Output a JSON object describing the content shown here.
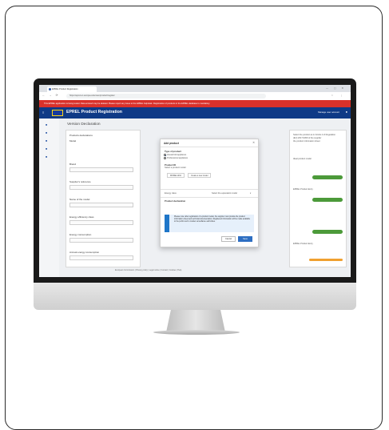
{
  "browser": {
    "tab_title": "EPREL Product Registration",
    "url": "https://eprel.ec.europa.eu/screen/product/register",
    "banner_text": "This EPREL application is being tested. Data entered may be deleted. Please report any issue to the EPREL helpdesk. Registration of products in the EPREL database is mandatory."
  },
  "app": {
    "title": "EPREL Product Registration",
    "user": "Manage user account"
  },
  "sidebar": {
    "items": [
      "■",
      "■",
      "■",
      "■",
      "■"
    ]
  },
  "page": {
    "title": "Version Declaration",
    "form_labels": [
      "Products declarations",
      "Model",
      "Brand",
      "Supplier's reference",
      "Name of the model",
      "Energy efficiency class",
      "Energy consumption",
      "Annual energy consumption"
    ]
  },
  "right_panel": {
    "lines": [
      "Select the product as in Article 4 of Regulation",
      "(EU) 2017/1369 of the supplier",
      "the product information sheet",
      "Ideal product model",
      "EPREL Product Entry",
      "EPREL Product Entry"
    ],
    "buttons": [
      "Validate",
      "Validate"
    ]
  },
  "footer": {
    "text": "European Commission | Privacy policy | Legal notice | Contact | Cookies | Help"
  },
  "modal": {
    "title": "Add product",
    "section1_label": "Type of product",
    "options": [
      "Household appliance",
      "Professional appliance"
    ],
    "section2_label": "Product ID",
    "section2_hint": "Select a product model",
    "chips": [
      "MODEL1234",
      "Create a new model"
    ],
    "section3_left": "Energy class",
    "section3_right": "Select the equivalent model",
    "section4_label": "Product declaration",
    "info_text": "Please note: after registration of a product model, the supplier must provide the product information sheet and technical documentation. Registered information will be made available to the public and to market surveillance authorities.",
    "cancel_label": "Cancel",
    "ok_label": "Save"
  }
}
